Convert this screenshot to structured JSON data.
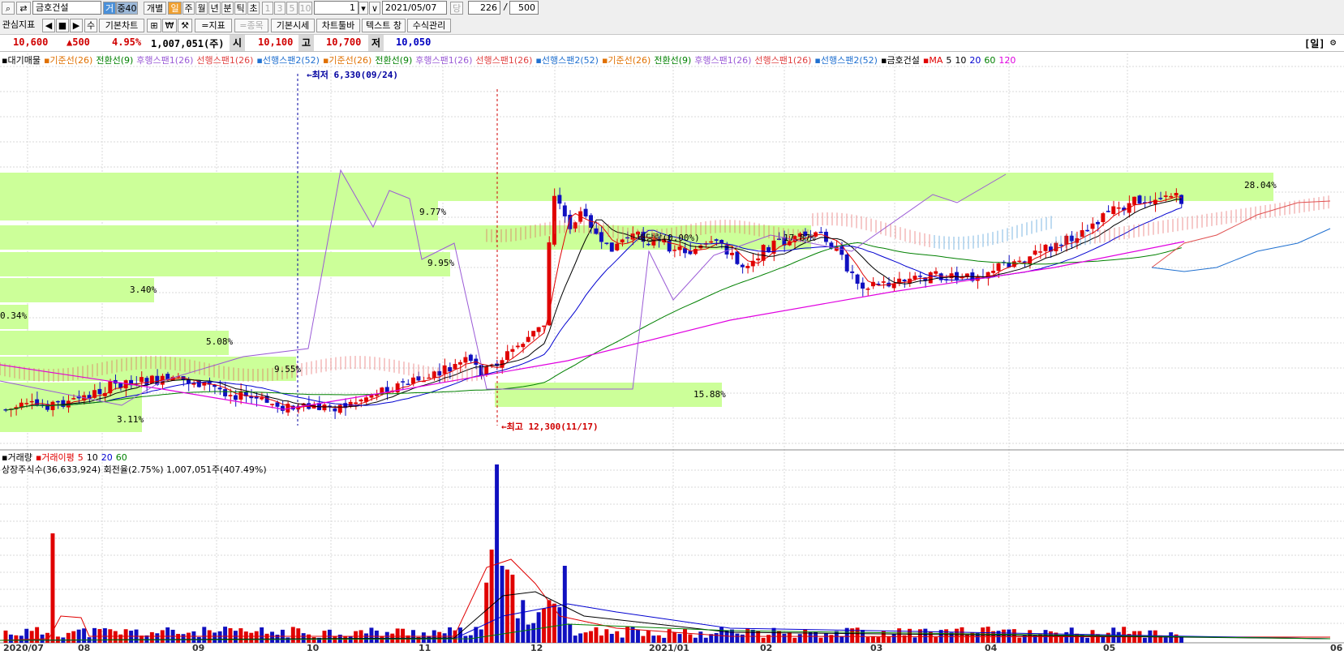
{
  "toolbar": {
    "stock_code": "금호건설",
    "btn_ga": "거",
    "btn_jung": "중40",
    "btn_gaebyul": "개별",
    "period_tabs": [
      "일",
      "주",
      "월",
      "년",
      "분",
      "틱",
      "초"
    ],
    "num_tabs": [
      "1",
      "3",
      "5",
      "10"
    ],
    "count_value": "1",
    "date_value": "2021/05/07",
    "dang_label": "당",
    "view_count": "226",
    "slash": "/",
    "total_count": "500",
    "row2": [
      "관심지표",
      "◀",
      "■",
      "▶",
      "수",
      "기본차트",
      "₩",
      "=지표",
      "=종목",
      "기본시세",
      "차트툴바",
      "텍스트 창",
      "수식관리"
    ]
  },
  "quote": {
    "price": "10,600",
    "change": "▲500",
    "rate": "4.95%",
    "volume": "1,007,051(주)",
    "open_label": "시",
    "open": "10,100",
    "high_label": "고",
    "high": "10,700",
    "low_label": "저",
    "low": "10,050",
    "period": "[일]"
  },
  "legend_price": [
    {
      "text": "▪대기매물",
      "color": "#000000"
    },
    {
      "text": "▪기준선(26)",
      "color": "#e07000"
    },
    {
      "text": "전환선(9)",
      "color": "#008000"
    },
    {
      "text": "후행스팬1(26)",
      "color": "#9a5ad6"
    },
    {
      "text": "선행스팬1(26)",
      "color": "#e04040"
    },
    {
      "text": "▪선행스팬2(52)",
      "color": "#2070d0"
    },
    {
      "text": "▪기준선(26)",
      "color": "#e07000"
    },
    {
      "text": "전환선(9)",
      "color": "#008000"
    },
    {
      "text": "후행스팬1(26)",
      "color": "#9a5ad6"
    },
    {
      "text": "선행스팬1(26)",
      "color": "#e04040"
    },
    {
      "text": "▪선행스팬2(52)",
      "color": "#2070d0"
    },
    {
      "text": "▪기준선(26)",
      "color": "#e07000"
    },
    {
      "text": "전환선(9)",
      "color": "#008000"
    },
    {
      "text": "후행스팬1(26)",
      "color": "#9a5ad6"
    },
    {
      "text": "선행스팬1(26)",
      "color": "#e04040"
    },
    {
      "text": "▪선행스팬2(52)",
      "color": "#2070d0"
    },
    {
      "text": "▪금호건설",
      "color": "#000000"
    },
    {
      "text": "▪MA",
      "color": "#e00000"
    },
    {
      "text": "5",
      "color": "#000000"
    },
    {
      "text": "10",
      "color": "#000000"
    },
    {
      "text": "20",
      "color": "#0000d0"
    },
    {
      "text": "60",
      "color": "#008000"
    },
    {
      "text": "120",
      "color": "#e000e0"
    }
  ],
  "legend_volume": [
    {
      "text": "▪거래량",
      "color": "#000000"
    },
    {
      "text": "▪거래이평",
      "color": "#e00000"
    },
    {
      "text": "5",
      "color": "#e00000"
    },
    {
      "text": "10",
      "color": "#000000"
    },
    {
      "text": "20",
      "color": "#0000d0"
    },
    {
      "text": "60",
      "color": "#008000"
    }
  ],
  "volume_info": "상장주식수(36,633,924) 회전율(2.75%) 1,007,051주(407.49%)",
  "annotations": {
    "low_mark": "최저 6,330(09/24)",
    "high_mark": "최고 12,300(11/17)",
    "dividend": "배당락(0.00%)",
    "pct_28": "28.04%",
    "pct_977": "9.77%",
    "pct_995": "9.95%",
    "pct_340": "3.40%",
    "pct_034": "0.34%",
    "pct_508": "5.08%",
    "pct_955": "9.55%",
    "pct_311": "3.11%",
    "pct_1588": "15.88%",
    "pct_1787": "17.87%"
  },
  "x_axis": [
    "2020/07",
    "08",
    "09",
    "10",
    "11",
    "12",
    "2021/01",
    "02",
    "03",
    "04",
    "05",
    "06"
  ],
  "colors": {
    "up": "#e00000",
    "down": "#1010c0",
    "band": "#ccff99",
    "grid": "#d8d8d8"
  },
  "chart_data": {
    "type": "candlestick",
    "title": "금호건설",
    "period": "daily",
    "x_range": [
      "2020/07",
      "2021/06"
    ],
    "ma_periods": [
      5,
      10,
      20,
      60,
      120
    ],
    "visible_candles": 226,
    "last_candle": {
      "date": "2021/05/07",
      "open": 10100,
      "high": 10700,
      "low": 10050,
      "close": 10600,
      "volume": 1007051
    },
    "lowest": {
      "date": "09/24",
      "price": 6330
    },
    "highest": {
      "date": "11/17",
      "price": 12300
    }
  }
}
